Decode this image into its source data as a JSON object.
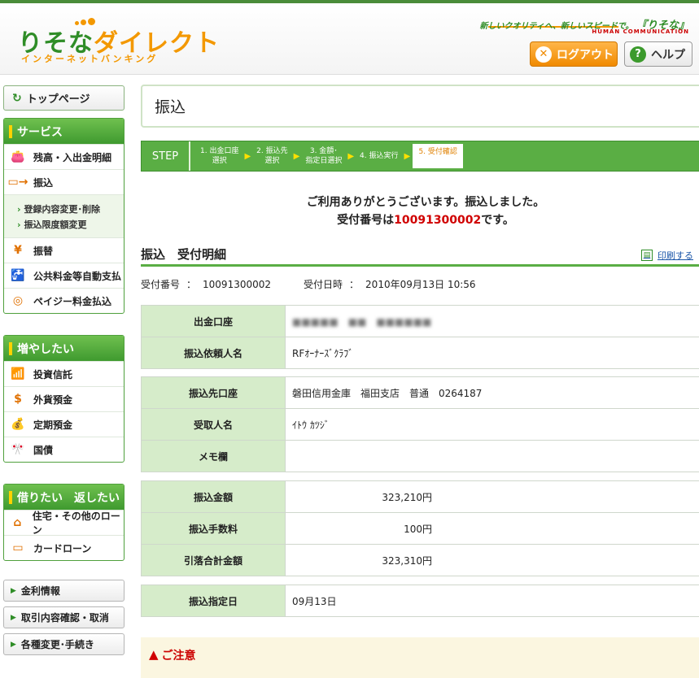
{
  "header": {
    "logo_main": "りそなダイレクト",
    "logo_main_a": "りそな",
    "logo_main_b": "ダイレクト",
    "logo_sub": "インターネットバンキング",
    "tagline": "新しいクオリティへ、新しいスピードで。",
    "tagline_brand": "『りそな』",
    "tagline_under": "HUMAN COMMUNICATION",
    "logout_label": "ログアウト",
    "help_label": "ヘルプ"
  },
  "sidebar": {
    "top_page": "トップページ",
    "services": {
      "title": "サービス",
      "items": [
        {
          "label": "残高・入出金明細",
          "icon": "wallet-icon"
        },
        {
          "label": "振込",
          "icon": "transfer-icon"
        }
      ],
      "subitems": [
        "登録内容変更･削除",
        "振込限度額変更"
      ],
      "items2": [
        {
          "label": "振替",
          "icon": "yen-exchange-icon"
        },
        {
          "label": "公共料金等自動支払",
          "icon": "faucet-icon"
        },
        {
          "label": "ペイジー料金払込",
          "icon": "coin-icon"
        }
      ]
    },
    "grow": {
      "title": "増やしたい",
      "items": [
        {
          "label": "投資信託",
          "icon": "chart-icon"
        },
        {
          "label": "外貨預金",
          "icon": "dollar-icon"
        },
        {
          "label": "定期預金",
          "icon": "money-bag-icon"
        },
        {
          "label": "国債",
          "icon": "flag-icon"
        }
      ]
    },
    "borrow": {
      "title": "借りたい　返したい",
      "items": [
        {
          "label": "住宅・その他のローン",
          "icon": "house-icon"
        },
        {
          "label": "カードローン",
          "icon": "card-icon"
        }
      ]
    },
    "links": [
      "金利情報",
      "取引内容確認・取消",
      "各種変更･手続き"
    ]
  },
  "main": {
    "page_title": "振込",
    "step_label": "STEP",
    "steps": [
      {
        "l1": "1. 出金口座",
        "l2": "選択"
      },
      {
        "l1": "2. 振込先",
        "l2": "選択"
      },
      {
        "l1": "3. 金額･",
        "l2": "指定日選択"
      },
      {
        "l1": "4. 振込実行",
        "l2": ""
      },
      {
        "l1": "5. 受付確認",
        "l2": ""
      }
    ],
    "thanks_line1": "ご利用ありがとうございます。振込しました。",
    "thanks_prefix": "受付番号は",
    "thanks_number": "10091300002",
    "thanks_suffix": "です。",
    "section_title": "振込　受付明細",
    "print_label": "印刷する",
    "meta": {
      "receipt_label": "受付番号",
      "receipt_value": "10091300002",
      "datetime_label": "受付日時",
      "datetime_value": "2010年09月13日 10:56",
      "sep": "："
    },
    "table1": [
      {
        "label": "出金口座",
        "value": "■■■■■　■■　■■■■■■"
      },
      {
        "label": "振込依頼人名",
        "value": "RFｵｰﾅｰｽﾞｸﾗﾌﾞ"
      }
    ],
    "table2": [
      {
        "label": "振込先口座",
        "value": "磐田信用金庫　福田支店　普通　0264187"
      },
      {
        "label": "受取人名",
        "value": "ｲﾄｳ ｶﾂｼﾞ"
      },
      {
        "label": "メモ欄",
        "value": ""
      }
    ],
    "table3": [
      {
        "label": "振込金額",
        "value": "323,210円"
      },
      {
        "label": "振込手数料",
        "value": "100円"
      },
      {
        "label": "引落合計金額",
        "value": "323,310円"
      }
    ],
    "table4": [
      {
        "label": "振込指定日",
        "value": "09月13日"
      }
    ],
    "caution_label": "ご注意"
  }
}
